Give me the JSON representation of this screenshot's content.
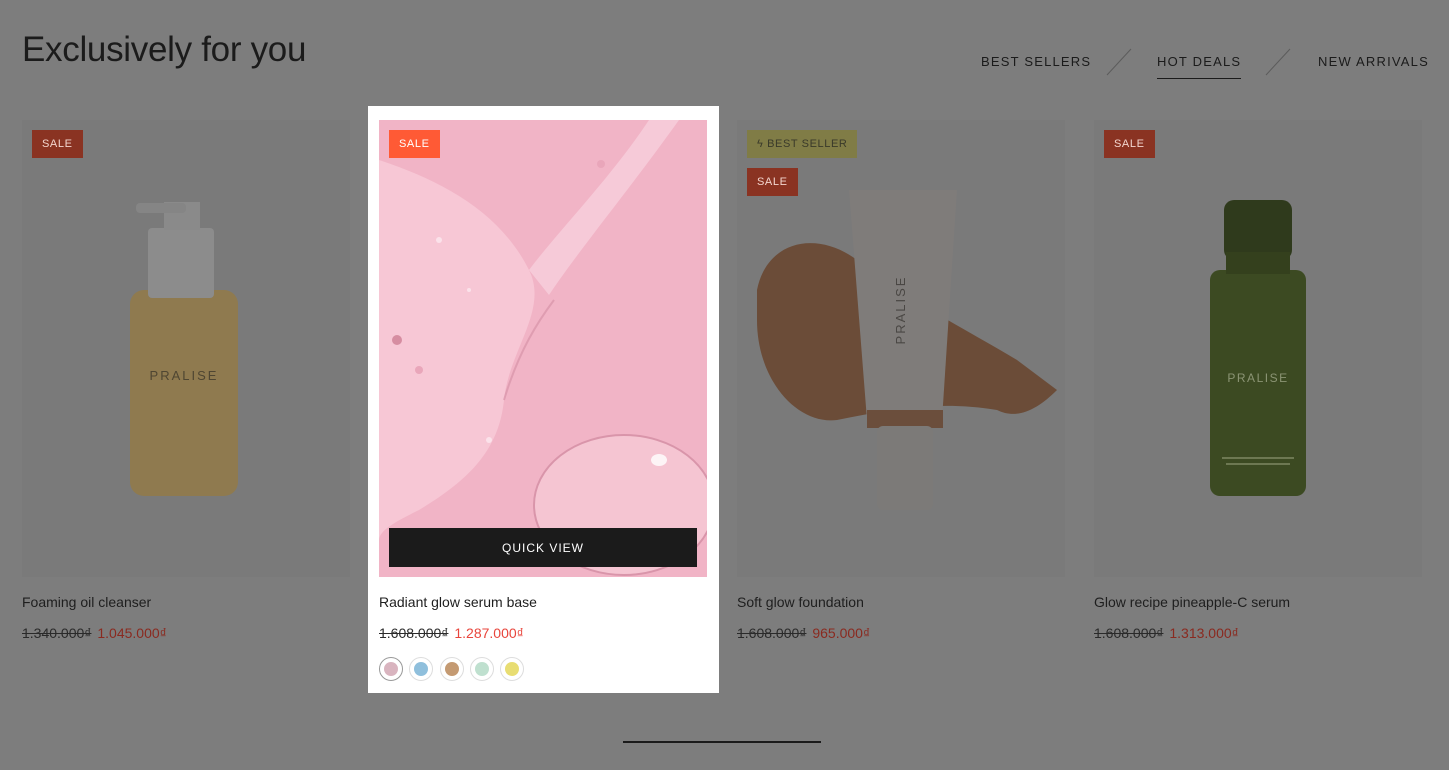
{
  "header": {
    "title": "Exclusively for you",
    "tabs": [
      {
        "label": "BEST SELLERS",
        "active": false
      },
      {
        "label": "HOT DEALS",
        "active": true
      },
      {
        "label": "NEW ARRIVALS",
        "active": false
      }
    ]
  },
  "products": [
    {
      "name": "Foaming oil cleanser",
      "old_price": "1.340.000₫",
      "price": "1.045.000₫",
      "badges": [
        "SALE"
      ],
      "brand": "PRALISE"
    },
    {
      "name": "Radiant glow serum base",
      "old_price": "1.608.000₫",
      "price": "1.287.000₫",
      "badges": [
        "SALE"
      ],
      "quick_view": "QUICK VIEW",
      "swatches": [
        "#d9b4bf",
        "#8fbfdc",
        "#c49a72",
        "#bfe0cf",
        "#e8dd72"
      ]
    },
    {
      "name": "Soft glow foundation",
      "old_price": "1.608.000₫",
      "price": "965.000₫",
      "badges": [
        "BEST SELLER",
        "SALE"
      ],
      "brand": "PRALISE"
    },
    {
      "name": "Glow recipe pineapple-C serum",
      "old_price": "1.608.000₫",
      "price": "1.313.000₫",
      "badges": [
        "SALE"
      ],
      "brand": "PRALISE"
    }
  ],
  "colors": {
    "sale_badge": "#ff5a35",
    "price_sale": "#e8453c",
    "overlay": "#7d7d7d"
  }
}
